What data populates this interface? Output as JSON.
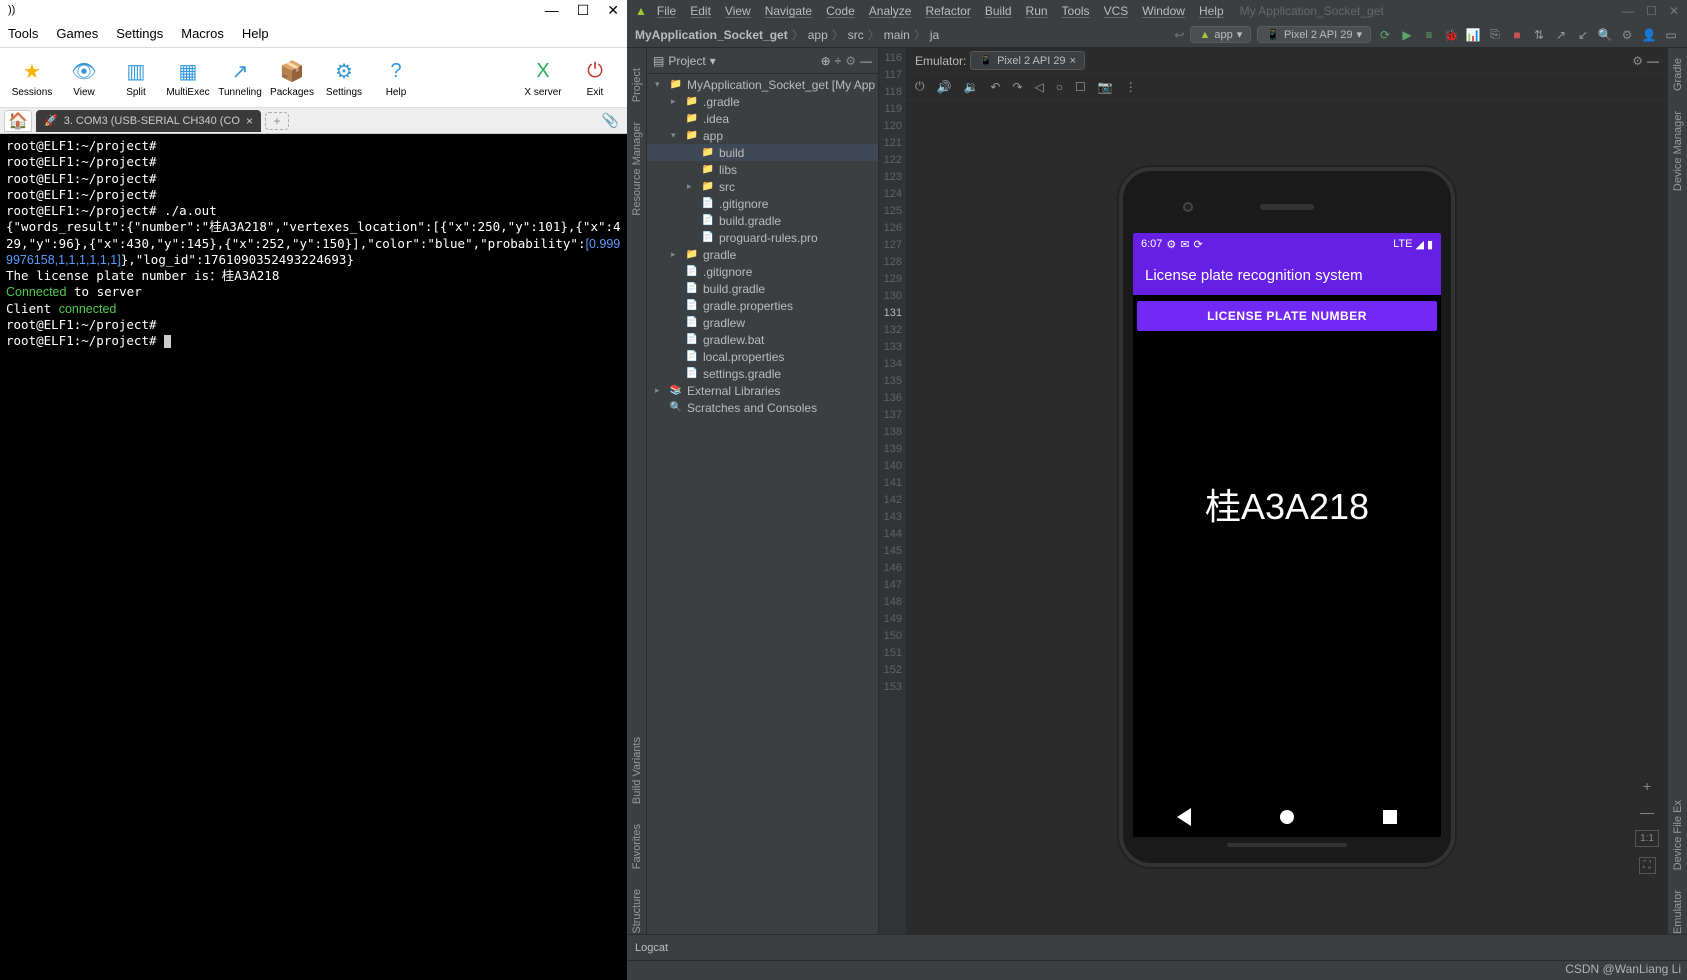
{
  "left": {
    "title_suffix": "))",
    "menu": [
      "Tools",
      "Games",
      "Settings",
      "Macros",
      "Help"
    ],
    "toolbar": [
      {
        "label": "Sessions",
        "color": "#f5b301",
        "glyph": "★"
      },
      {
        "label": "View",
        "color": "#3498db",
        "glyph": "👁"
      },
      {
        "label": "Split",
        "color": "#3498db",
        "glyph": "▥"
      },
      {
        "label": "MultiExec",
        "color": "#3498db",
        "glyph": "▦"
      },
      {
        "label": "Tunneling",
        "color": "#3498db",
        "glyph": "↗"
      },
      {
        "label": "Packages",
        "color": "#d4a354",
        "glyph": "📦"
      },
      {
        "label": "Settings",
        "color": "#3498db",
        "glyph": "⚙"
      },
      {
        "label": "Help",
        "color": "#3498db",
        "glyph": "?"
      }
    ],
    "toolbar_right": [
      {
        "label": "X server",
        "color": "#27ae60",
        "glyph": "X"
      },
      {
        "label": "Exit",
        "color": "#c0392b",
        "glyph": "⏻"
      }
    ],
    "tab": "3. COM3  (USB-SERIAL CH340 (CO",
    "prompt": "root@ELF1:~/project#",
    "cmd": " ./a.out",
    "json_line_1": "{\"words_result\":{\"number\":\"桂A3A218\",\"vertexes_location\":[{\"x\":250,\"y\":101},{\"x\":429,\"y\":96},{\"x\":430,\"y\":145},{\"x\":252,\"y\":150}],\"color\":\"blue\",\"probability\":",
    "json_prob": "[0.9999976158,1,1,1,1,1,1]",
    "json_line_2": "},\"log_id\":1761090352493224693}",
    "plate_line": "The license plate number is：桂A3A218",
    "conn_1a": "Connected",
    "conn_1b": " to server",
    "conn_2a": "Client ",
    "conn_2b": "connected"
  },
  "as": {
    "menu": [
      "File",
      "Edit",
      "View",
      "Navigate",
      "Code",
      "Analyze",
      "Refactor",
      "Build",
      "Run",
      "Tools",
      "VCS",
      "Window",
      "Help"
    ],
    "project_title": "My Application_Socket_get",
    "breadcrumbs": [
      "MyApplication_Socket_get",
      "app",
      "src",
      "main",
      "ja"
    ],
    "run_config": "app",
    "device_config": "Pixel 2 API 29",
    "panel_title": "Project",
    "tree": [
      {
        "indent": 0,
        "arrow": "▾",
        "ico": "📁",
        "cls": "folder-blue",
        "label": "MyApplication_Socket_get",
        "suffix": " [My App"
      },
      {
        "indent": 1,
        "arrow": "▸",
        "ico": "📁",
        "cls": "folder-orange",
        "label": ".gradle"
      },
      {
        "indent": 1,
        "arrow": "",
        "ico": "📁",
        "cls": "folder-ico",
        "label": ".idea"
      },
      {
        "indent": 1,
        "arrow": "▾",
        "ico": "📁",
        "cls": "folder-blue",
        "label": "app"
      },
      {
        "indent": 2,
        "arrow": "",
        "ico": "📁",
        "cls": "folder-orange",
        "label": "build",
        "sel": true
      },
      {
        "indent": 2,
        "arrow": "",
        "ico": "📁",
        "cls": "folder-ico",
        "label": "libs"
      },
      {
        "indent": 2,
        "arrow": "▸",
        "ico": "📁",
        "cls": "folder-ico",
        "label": "src"
      },
      {
        "indent": 2,
        "arrow": "",
        "ico": "📄",
        "cls": "",
        "label": ".gitignore"
      },
      {
        "indent": 2,
        "arrow": "",
        "ico": "📄",
        "cls": "",
        "label": "build.gradle"
      },
      {
        "indent": 2,
        "arrow": "",
        "ico": "📄",
        "cls": "",
        "label": "proguard-rules.pro"
      },
      {
        "indent": 1,
        "arrow": "▸",
        "ico": "📁",
        "cls": "folder-ico",
        "label": "gradle"
      },
      {
        "indent": 1,
        "arrow": "",
        "ico": "📄",
        "cls": "",
        "label": ".gitignore"
      },
      {
        "indent": 1,
        "arrow": "",
        "ico": "📄",
        "cls": "",
        "label": "build.gradle"
      },
      {
        "indent": 1,
        "arrow": "",
        "ico": "📄",
        "cls": "",
        "label": "gradle.properties"
      },
      {
        "indent": 1,
        "arrow": "",
        "ico": "📄",
        "cls": "",
        "label": "gradlew"
      },
      {
        "indent": 1,
        "arrow": "",
        "ico": "📄",
        "cls": "",
        "label": "gradlew.bat"
      },
      {
        "indent": 1,
        "arrow": "",
        "ico": "📄",
        "cls": "",
        "label": "local.properties"
      },
      {
        "indent": 1,
        "arrow": "",
        "ico": "📄",
        "cls": "",
        "label": "settings.gradle"
      },
      {
        "indent": 0,
        "arrow": "▸",
        "ico": "📚",
        "cls": "",
        "label": "External Libraries"
      },
      {
        "indent": 0,
        "arrow": "",
        "ico": "🔍",
        "cls": "",
        "label": "Scratches and Consoles"
      }
    ],
    "line_start": 116,
    "line_end": 153,
    "line_hl": 131,
    "emulator_label": "Emulator:",
    "emulator_tab": "Pixel 2 API 29",
    "side_left": [
      "Project",
      "Resource Manager"
    ],
    "side_left_bottom": [
      "Build Variants",
      "Favorites",
      "Structure"
    ],
    "side_right": [
      "Gradle",
      "Device Manager"
    ],
    "side_right_bottom": [
      "Device File Ex",
      "Emulator"
    ],
    "logcat": "Logcat",
    "zoom": "1:1",
    "phone": {
      "time": "6:07",
      "signal": "LTE",
      "title": "License plate recognition system",
      "button": "LICENSE PLATE NUMBER",
      "plate": "桂A3A218"
    }
  },
  "watermark": "CSDN @WanLiang Li"
}
